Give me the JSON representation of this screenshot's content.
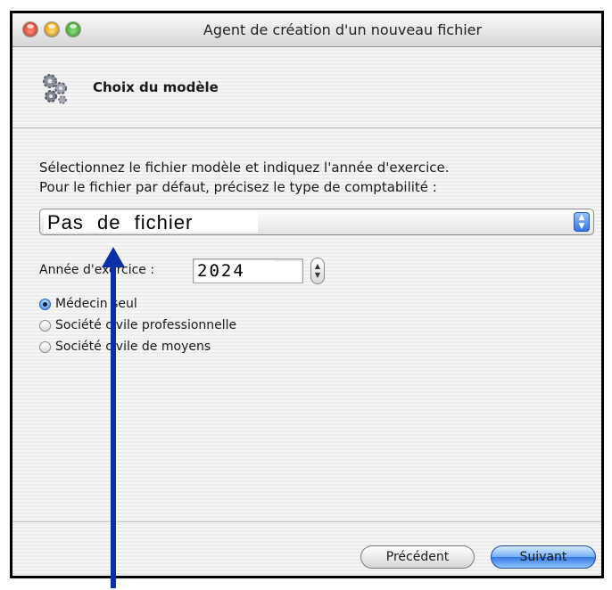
{
  "window": {
    "title": "Agent de création d'un nouveau fichier"
  },
  "header": {
    "title": "Choix du modèle",
    "icon": "wizard-gears-icon"
  },
  "instructions": {
    "line1": "Sélectionnez le fichier modèle et indiquez l'année d'exercice.",
    "line2": "Pour le fichier par défaut, précisez le type de comptabilité :"
  },
  "template_popup": {
    "value": "Pas de fichier"
  },
  "year": {
    "label": "Année d'exercice :",
    "value": "2024"
  },
  "accounting_type": {
    "options": [
      {
        "label": "Médecin seul",
        "checked": true
      },
      {
        "label": "Société civile professionnelle",
        "checked": false
      },
      {
        "label": "Société civile de moyens",
        "checked": false
      }
    ]
  },
  "buttons": {
    "previous": "Précédent",
    "next": "Suivant"
  },
  "annotation": {
    "arrow_color": "#0a2fa6"
  },
  "colors": {
    "accent": "#3578e3"
  }
}
